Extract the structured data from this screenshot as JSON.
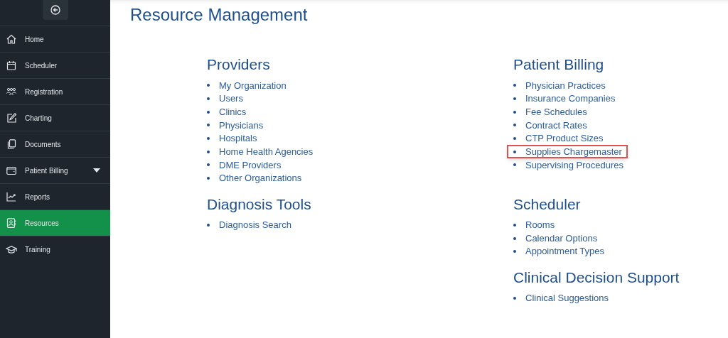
{
  "sidebar": {
    "items": [
      {
        "label": "Home",
        "selected": false
      },
      {
        "label": "Scheduler",
        "selected": false
      },
      {
        "label": "Registration",
        "selected": false
      },
      {
        "label": "Charting",
        "selected": false
      },
      {
        "label": "Documents",
        "selected": false
      },
      {
        "label": "Patient Billing",
        "selected": false,
        "expandable": true
      },
      {
        "label": "Reports",
        "selected": false
      },
      {
        "label": "Resources",
        "selected": true
      },
      {
        "label": "Training",
        "selected": false
      }
    ]
  },
  "title": "Resource Management",
  "columns": [
    {
      "sections": [
        {
          "heading": "Providers",
          "items": [
            {
              "label": "My Organization",
              "highlighted": false
            },
            {
              "label": "Users",
              "highlighted": false
            },
            {
              "label": "Clinics",
              "highlighted": false
            },
            {
              "label": "Physicians",
              "highlighted": false
            },
            {
              "label": "Hospitals",
              "highlighted": false
            },
            {
              "label": "Home Health Agencies",
              "highlighted": false
            },
            {
              "label": "DME Providers",
              "highlighted": false
            },
            {
              "label": "Other Organizations",
              "highlighted": false
            }
          ]
        },
        {
          "heading": "Diagnosis Tools",
          "items": [
            {
              "label": "Diagnosis Search",
              "highlighted": false
            }
          ]
        }
      ]
    },
    {
      "sections": [
        {
          "heading": "Patient Billing",
          "items": [
            {
              "label": "Physician Practices",
              "highlighted": false
            },
            {
              "label": "Insurance Companies",
              "highlighted": false
            },
            {
              "label": "Fee Schedules",
              "highlighted": false
            },
            {
              "label": "Contract Rates",
              "highlighted": false
            },
            {
              "label": "CTP Product Sizes",
              "highlighted": false
            },
            {
              "label": "Supplies Chargemaster",
              "highlighted": true
            },
            {
              "label": "Supervising Procedures",
              "highlighted": false
            }
          ]
        },
        {
          "heading": "Scheduler",
          "items": [
            {
              "label": "Rooms",
              "highlighted": false
            },
            {
              "label": "Calendar Options",
              "highlighted": false
            },
            {
              "label": "Appointment Types",
              "highlighted": false
            }
          ]
        },
        {
          "heading": "Clinical Decision Support",
          "items": [
            {
              "label": "Clinical Suggestions",
              "highlighted": false
            }
          ]
        }
      ]
    }
  ]
}
